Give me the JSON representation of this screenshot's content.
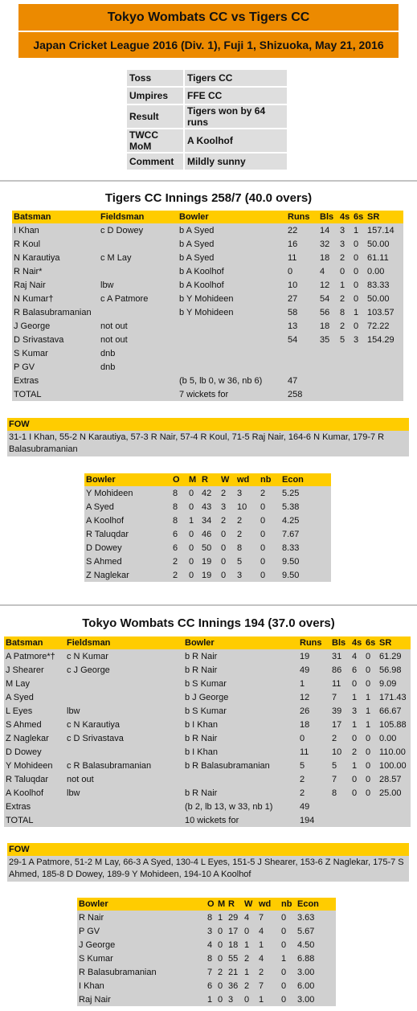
{
  "header": {
    "title": "Tokyo Wombats CC vs Tigers CC",
    "subtitle": "Japan Cricket League 2016 (Div. 1), Fuji 1, Shizuoka, May 21, 2016"
  },
  "match_info": [
    {
      "key": "Toss",
      "value": "Tigers CC"
    },
    {
      "key": "Umpires",
      "value": "FFE CC"
    },
    {
      "key": "Result",
      "value": "Tigers won by 64 runs"
    },
    {
      "key": "TWCC MoM",
      "value": "A Koolhof"
    },
    {
      "key": "Comment",
      "value": "Mildly sunny"
    }
  ],
  "batting_headers": [
    "Batsman",
    "Fieldsman",
    "Bowler",
    "Runs",
    "Bls",
    "4s",
    "6s",
    "SR"
  ],
  "bowling_headers": [
    "Bowler",
    "O",
    "M",
    "R",
    "W",
    "wd",
    "nb",
    "Econ"
  ],
  "fow_label": "FOW",
  "innings": [
    {
      "title": "Tigers CC Innings 258/7 (40.0 overs)",
      "batting": [
        [
          "I Khan",
          "c D Dowey",
          "b A Syed",
          "22",
          "14",
          "3",
          "1",
          "157.14"
        ],
        [
          "R Koul",
          "",
          "b A Syed",
          "16",
          "32",
          "3",
          "0",
          "50.00"
        ],
        [
          "N Karautiya",
          "c M Lay",
          "b A Syed",
          "11",
          "18",
          "2",
          "0",
          "61.11"
        ],
        [
          "R Nair*",
          "",
          "b A Koolhof",
          "0",
          "4",
          "0",
          "0",
          "0.00"
        ],
        [
          "Raj Nair",
          "lbw",
          "b A Koolhof",
          "10",
          "12",
          "1",
          "0",
          "83.33"
        ],
        [
          "N Kumar†",
          "c A Patmore",
          "b Y Mohideen",
          "27",
          "54",
          "2",
          "0",
          "50.00"
        ],
        [
          "R Balasubramanian",
          "",
          "b Y Mohideen",
          "58",
          "56",
          "8",
          "1",
          "103.57"
        ],
        [
          "J George",
          "not out",
          "",
          "13",
          "18",
          "2",
          "0",
          "72.22"
        ],
        [
          "D Srivastava",
          "not out",
          "",
          "54",
          "35",
          "5",
          "3",
          "154.29"
        ],
        [
          "S Kumar",
          "dnb",
          "",
          "",
          "",
          "",
          "",
          ""
        ],
        [
          "P GV",
          "dnb",
          "",
          "",
          "",
          "",
          "",
          ""
        ],
        [
          "Extras",
          "",
          "(b 5, lb 0, w 36, nb 6)",
          "47",
          "",
          "",
          "",
          ""
        ],
        [
          "TOTAL",
          "",
          "7 wickets for",
          "258",
          "",
          "",
          "",
          ""
        ]
      ],
      "fow": "31-1 I Khan, 55-2 N Karautiya, 57-3 R Nair, 57-4 R Koul, 71-5 Raj Nair, 164-6 N Kumar, 179-7 R Balasubramanian",
      "bowling": [
        [
          "Y Mohideen",
          "8",
          "0",
          "42",
          "2",
          "3",
          "2",
          "5.25"
        ],
        [
          "A Syed",
          "8",
          "0",
          "43",
          "3",
          "10",
          "0",
          "5.38"
        ],
        [
          "A Koolhof",
          "8",
          "1",
          "34",
          "2",
          "2",
          "0",
          "4.25"
        ],
        [
          "R Taluqdar",
          "6",
          "0",
          "46",
          "0",
          "2",
          "0",
          "7.67"
        ],
        [
          "D Dowey",
          "6",
          "0",
          "50",
          "0",
          "8",
          "0",
          "8.33"
        ],
        [
          "S Ahmed",
          "2",
          "0",
          "19",
          "0",
          "5",
          "0",
          "9.50"
        ],
        [
          "Z Naglekar",
          "2",
          "0",
          "19",
          "0",
          "3",
          "0",
          "9.50"
        ]
      ]
    },
    {
      "title": "Tokyo Wombats CC Innings 194 (37.0 overs)",
      "batting": [
        [
          "A Patmore*†",
          "c N Kumar",
          "b R Nair",
          "19",
          "31",
          "4",
          "0",
          "61.29"
        ],
        [
          "J Shearer",
          "c J George",
          "b R Nair",
          "49",
          "86",
          "6",
          "0",
          "56.98"
        ],
        [
          "M Lay",
          "",
          "b S Kumar",
          "1",
          "11",
          "0",
          "0",
          "9.09"
        ],
        [
          "A Syed",
          "",
          "b J George",
          "12",
          "7",
          "1",
          "1",
          "171.43"
        ],
        [
          "L Eyes",
          "lbw",
          "b S Kumar",
          "26",
          "39",
          "3",
          "1",
          "66.67"
        ],
        [
          "S Ahmed",
          "c N Karautiya",
          "b I Khan",
          "18",
          "17",
          "1",
          "1",
          "105.88"
        ],
        [
          "Z Naglekar",
          "c D Srivastava",
          "b R Nair",
          "0",
          "2",
          "0",
          "0",
          "0.00"
        ],
        [
          "D Dowey",
          "",
          "b I Khan",
          "11",
          "10",
          "2",
          "0",
          "110.00"
        ],
        [
          "Y Mohideen",
          "c R Balasubramanian",
          "b R Balasubramanian",
          "5",
          "5",
          "1",
          "0",
          "100.00"
        ],
        [
          "R Taluqdar",
          "not out",
          "",
          "2",
          "7",
          "0",
          "0",
          "28.57"
        ],
        [
          "A Koolhof",
          "lbw",
          "b R Nair",
          "2",
          "8",
          "0",
          "0",
          "25.00"
        ],
        [
          "Extras",
          "",
          "(b 2, lb 13, w 33, nb 1)",
          "49",
          "",
          "",
          "",
          ""
        ],
        [
          "TOTAL",
          "",
          "10 wickets for",
          "194",
          "",
          "",
          "",
          ""
        ]
      ],
      "fow": "29-1 A Patmore, 51-2 M Lay, 66-3 A Syed, 130-4 L Eyes, 151-5 J Shearer, 153-6 Z Naglekar, 175-7 S Ahmed, 185-8 D Dowey, 189-9 Y Mohideen, 194-10 A Koolhof",
      "bowling": [
        [
          "R Nair",
          "8",
          "1",
          "29",
          "4",
          "7",
          "0",
          "3.63"
        ],
        [
          "P GV",
          "3",
          "0",
          "17",
          "0",
          "4",
          "0",
          "5.67"
        ],
        [
          "J George",
          "4",
          "0",
          "18",
          "1",
          "1",
          "0",
          "4.50"
        ],
        [
          "S Kumar",
          "8",
          "0",
          "55",
          "2",
          "4",
          "1",
          "6.88"
        ],
        [
          "R Balasubramanian",
          "7",
          "2",
          "21",
          "1",
          "2",
          "0",
          "3.00"
        ],
        [
          "I Khan",
          "6",
          "0",
          "36",
          "2",
          "7",
          "0",
          "6.00"
        ],
        [
          "Raj Nair",
          "1",
          "0",
          "3",
          "0",
          "1",
          "0",
          "3.00"
        ]
      ]
    }
  ]
}
